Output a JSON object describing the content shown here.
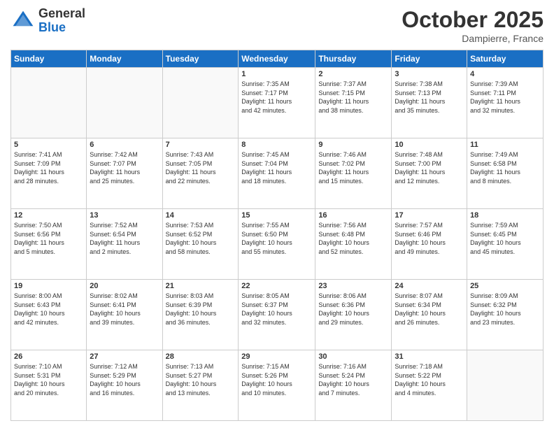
{
  "header": {
    "logo_general": "General",
    "logo_blue": "Blue",
    "month_title": "October 2025",
    "location": "Dampierre, France"
  },
  "days_of_week": [
    "Sunday",
    "Monday",
    "Tuesday",
    "Wednesday",
    "Thursday",
    "Friday",
    "Saturday"
  ],
  "weeks": [
    [
      {
        "day": "",
        "info": ""
      },
      {
        "day": "",
        "info": ""
      },
      {
        "day": "",
        "info": ""
      },
      {
        "day": "1",
        "info": "Sunrise: 7:35 AM\nSunset: 7:17 PM\nDaylight: 11 hours\nand 42 minutes."
      },
      {
        "day": "2",
        "info": "Sunrise: 7:37 AM\nSunset: 7:15 PM\nDaylight: 11 hours\nand 38 minutes."
      },
      {
        "day": "3",
        "info": "Sunrise: 7:38 AM\nSunset: 7:13 PM\nDaylight: 11 hours\nand 35 minutes."
      },
      {
        "day": "4",
        "info": "Sunrise: 7:39 AM\nSunset: 7:11 PM\nDaylight: 11 hours\nand 32 minutes."
      }
    ],
    [
      {
        "day": "5",
        "info": "Sunrise: 7:41 AM\nSunset: 7:09 PM\nDaylight: 11 hours\nand 28 minutes."
      },
      {
        "day": "6",
        "info": "Sunrise: 7:42 AM\nSunset: 7:07 PM\nDaylight: 11 hours\nand 25 minutes."
      },
      {
        "day": "7",
        "info": "Sunrise: 7:43 AM\nSunset: 7:05 PM\nDaylight: 11 hours\nand 22 minutes."
      },
      {
        "day": "8",
        "info": "Sunrise: 7:45 AM\nSunset: 7:04 PM\nDaylight: 11 hours\nand 18 minutes."
      },
      {
        "day": "9",
        "info": "Sunrise: 7:46 AM\nSunset: 7:02 PM\nDaylight: 11 hours\nand 15 minutes."
      },
      {
        "day": "10",
        "info": "Sunrise: 7:48 AM\nSunset: 7:00 PM\nDaylight: 11 hours\nand 12 minutes."
      },
      {
        "day": "11",
        "info": "Sunrise: 7:49 AM\nSunset: 6:58 PM\nDaylight: 11 hours\nand 8 minutes."
      }
    ],
    [
      {
        "day": "12",
        "info": "Sunrise: 7:50 AM\nSunset: 6:56 PM\nDaylight: 11 hours\nand 5 minutes."
      },
      {
        "day": "13",
        "info": "Sunrise: 7:52 AM\nSunset: 6:54 PM\nDaylight: 11 hours\nand 2 minutes."
      },
      {
        "day": "14",
        "info": "Sunrise: 7:53 AM\nSunset: 6:52 PM\nDaylight: 10 hours\nand 58 minutes."
      },
      {
        "day": "15",
        "info": "Sunrise: 7:55 AM\nSunset: 6:50 PM\nDaylight: 10 hours\nand 55 minutes."
      },
      {
        "day": "16",
        "info": "Sunrise: 7:56 AM\nSunset: 6:48 PM\nDaylight: 10 hours\nand 52 minutes."
      },
      {
        "day": "17",
        "info": "Sunrise: 7:57 AM\nSunset: 6:46 PM\nDaylight: 10 hours\nand 49 minutes."
      },
      {
        "day": "18",
        "info": "Sunrise: 7:59 AM\nSunset: 6:45 PM\nDaylight: 10 hours\nand 45 minutes."
      }
    ],
    [
      {
        "day": "19",
        "info": "Sunrise: 8:00 AM\nSunset: 6:43 PM\nDaylight: 10 hours\nand 42 minutes."
      },
      {
        "day": "20",
        "info": "Sunrise: 8:02 AM\nSunset: 6:41 PM\nDaylight: 10 hours\nand 39 minutes."
      },
      {
        "day": "21",
        "info": "Sunrise: 8:03 AM\nSunset: 6:39 PM\nDaylight: 10 hours\nand 36 minutes."
      },
      {
        "day": "22",
        "info": "Sunrise: 8:05 AM\nSunset: 6:37 PM\nDaylight: 10 hours\nand 32 minutes."
      },
      {
        "day": "23",
        "info": "Sunrise: 8:06 AM\nSunset: 6:36 PM\nDaylight: 10 hours\nand 29 minutes."
      },
      {
        "day": "24",
        "info": "Sunrise: 8:07 AM\nSunset: 6:34 PM\nDaylight: 10 hours\nand 26 minutes."
      },
      {
        "day": "25",
        "info": "Sunrise: 8:09 AM\nSunset: 6:32 PM\nDaylight: 10 hours\nand 23 minutes."
      }
    ],
    [
      {
        "day": "26",
        "info": "Sunrise: 7:10 AM\nSunset: 5:31 PM\nDaylight: 10 hours\nand 20 minutes."
      },
      {
        "day": "27",
        "info": "Sunrise: 7:12 AM\nSunset: 5:29 PM\nDaylight: 10 hours\nand 16 minutes."
      },
      {
        "day": "28",
        "info": "Sunrise: 7:13 AM\nSunset: 5:27 PM\nDaylight: 10 hours\nand 13 minutes."
      },
      {
        "day": "29",
        "info": "Sunrise: 7:15 AM\nSunset: 5:26 PM\nDaylight: 10 hours\nand 10 minutes."
      },
      {
        "day": "30",
        "info": "Sunrise: 7:16 AM\nSunset: 5:24 PM\nDaylight: 10 hours\nand 7 minutes."
      },
      {
        "day": "31",
        "info": "Sunrise: 7:18 AM\nSunset: 5:22 PM\nDaylight: 10 hours\nand 4 minutes."
      },
      {
        "day": "",
        "info": ""
      }
    ]
  ]
}
